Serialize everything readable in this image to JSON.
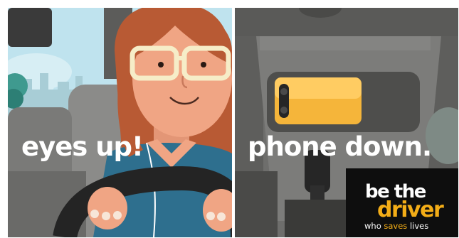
{
  "left_panel": {
    "caption": "eyes up!"
  },
  "right_panel": {
    "caption": "phone down."
  },
  "logo": {
    "line1": "be the",
    "line2": "driver",
    "tagline_pre": "who ",
    "tagline_accent": "saves",
    "tagline_post": " lives"
  },
  "colors": {
    "accent": "#f3ad17",
    "skin": "#f0a584",
    "hair": "#b85a34",
    "shirt": "#2e6f8e",
    "glasses": "#f6edc8",
    "car_interior": "#6e6e6c",
    "phone": "#f5b53a"
  }
}
